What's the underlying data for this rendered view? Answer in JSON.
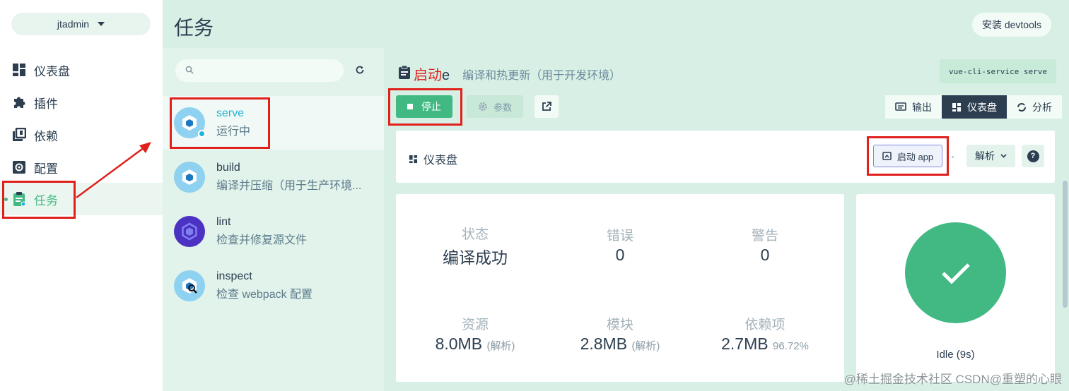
{
  "sidebar": {
    "project": "jtadmin",
    "items": [
      {
        "label": "仪表盘",
        "icon": "dashboard-icon"
      },
      {
        "label": "插件",
        "icon": "puzzle-icon"
      },
      {
        "label": "依赖",
        "icon": "library-icon"
      },
      {
        "label": "配置",
        "icon": "settings-icon"
      },
      {
        "label": "任务",
        "icon": "clipboard-icon",
        "active": true
      }
    ]
  },
  "header": {
    "title": "任务",
    "devtools_button": "安装 devtools"
  },
  "tasks": [
    {
      "name": "serve",
      "status": "运行中",
      "active": true
    },
    {
      "name": "build",
      "description": "编译并压缩（用于生产环境..."
    },
    {
      "name": "lint",
      "description": "检查并修复源文件"
    },
    {
      "name": "inspect",
      "description": "检查 webpack 配置"
    }
  ],
  "task_detail": {
    "annotation_label": "启动",
    "title_suffix": "e",
    "description": "编译和热更新（用于开发环境）",
    "command": "vue-cli-service serve",
    "stop_label": "停止",
    "params_label": "参数",
    "view_tabs": [
      {
        "label": "输出",
        "icon": "output-icon"
      },
      {
        "label": "仪表盘",
        "icon": "dashboard-icon",
        "active": true
      },
      {
        "label": "分析",
        "icon": "analyze-icon"
      }
    ],
    "dashboard_title": "仪表盘",
    "launch_app_label": "启动 app",
    "analyze_label": "解析",
    "help_glyph": "?"
  },
  "stats": {
    "status_label": "状态",
    "status_value": "编译成功",
    "errors_label": "错误",
    "errors_value": "0",
    "warnings_label": "警告",
    "warnings_value": "0",
    "assets_label": "资源",
    "assets_value": "8.0MB",
    "assets_note": "(解析)",
    "modules_label": "模块",
    "modules_value": "2.8MB",
    "modules_note": "(解析)",
    "deps_label": "依赖项",
    "deps_value": "2.7MB",
    "deps_note": "96.72%"
  },
  "build_status": {
    "text": "Idle (9s)",
    "color": "#42b983"
  },
  "watermark": "@稀土掘金技术社区 CSDN@重塑的心眼",
  "colors": {
    "accent": "#42b983",
    "header_bg": "#d7efe4",
    "annotation_red": "#e0201b"
  }
}
